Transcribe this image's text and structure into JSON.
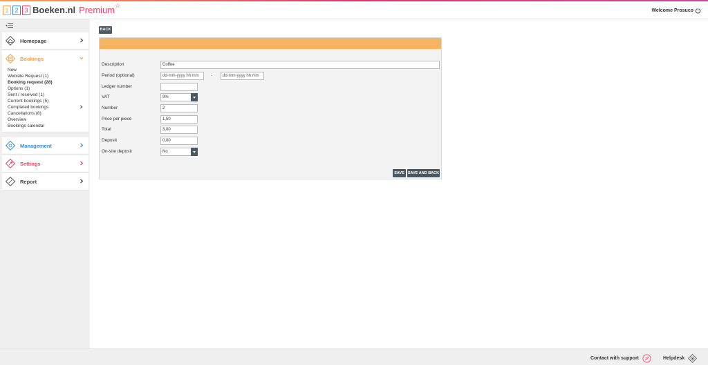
{
  "header": {
    "logo_digits": [
      "1",
      "2",
      "3"
    ],
    "brand_name": "Boeken.nl",
    "brand_suffix": "Premium",
    "brand_star": "☆",
    "welcome_text": "Welcome Prosuco",
    "colors": {
      "accent": "#e0436a",
      "orange": "#f2a44e",
      "blue": "#2f8fd8"
    }
  },
  "sidebar": {
    "menu_toggle_icon": "menu-collapse-icon",
    "homepage": {
      "label": "Homepage",
      "icon": "house-icon",
      "color": "#444444"
    },
    "bookings": {
      "label": "Bookings",
      "icon": "bookings-icon",
      "color": "#f0a04b",
      "items": [
        {
          "label": "New",
          "bold": false
        },
        {
          "label": "Website Request (1)",
          "bold": false
        },
        {
          "label": "Booking request (28)",
          "bold": true
        },
        {
          "label": "Options (1)",
          "bold": false
        },
        {
          "label": "Sent / received (1)",
          "bold": false
        },
        {
          "label": "Current bookings (5)",
          "bold": false
        },
        {
          "label": "Completed bookings",
          "bold": false
        },
        {
          "label": "Cancellations (8)",
          "bold": false
        },
        {
          "label": "Overview",
          "bold": false
        },
        {
          "label": "Bookings calendar",
          "bold": false
        }
      ]
    },
    "management": {
      "label": "Management",
      "icon": "management-icon",
      "color": "#2f8fd8"
    },
    "settings": {
      "label": "Settings",
      "icon": "settings-icon",
      "color": "#e0436a"
    },
    "report": {
      "label": "Report",
      "icon": "report-icon",
      "color": "#444444"
    }
  },
  "toolbar": {
    "back_label": "BACK"
  },
  "form": {
    "description_label": "Description",
    "description_value": "Coffee",
    "period_label": "Period (optional)",
    "period_start_placeholder": "dd-mm-yyyy hh:mm",
    "period_separator": "-",
    "period_end_placeholder": "dd-mm-yyyy hh:mm",
    "ledger_label": "Ledger number",
    "ledger_value": "",
    "vat_label": "VAT",
    "vat_value": "9%",
    "number_label": "Number",
    "number_value": "2",
    "price_label": "Price per piece",
    "price_value": "1,50",
    "total_label": "Total",
    "total_value": "3,00",
    "deposit_label": "Deposit",
    "deposit_value": "0,00",
    "onsite_label": "On-site deposit",
    "onsite_value": "No",
    "save_label": "SAVE",
    "save_back_label": "SAVE AND BACK",
    "header_color": "#f5b461"
  },
  "footer": {
    "support_label": "Contact with support",
    "support_icon": "rocket-icon",
    "helpdesk_label": "Helpdesk",
    "helpdesk_icon": "lifebuoy-icon"
  }
}
